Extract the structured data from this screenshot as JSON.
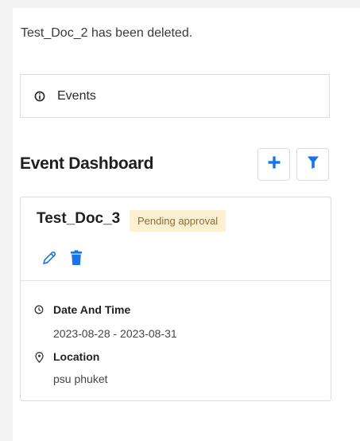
{
  "notification": {
    "message": "Test_Doc_2 has been deleted."
  },
  "events_section": {
    "label": "Events"
  },
  "dashboard": {
    "title": "Event Dashboard",
    "add_icon": "plus-icon",
    "filter_icon": "filter-icon",
    "accent_color": "#1a73e8"
  },
  "event_card": {
    "name": "Test_Doc_3",
    "status": "Pending approval",
    "status_bg": "#fcf0d3",
    "date_label": "Date And Time",
    "date_value": "2023-08-28 - 2023-08-31",
    "location_label": "Location",
    "location_value": "psu phuket"
  }
}
